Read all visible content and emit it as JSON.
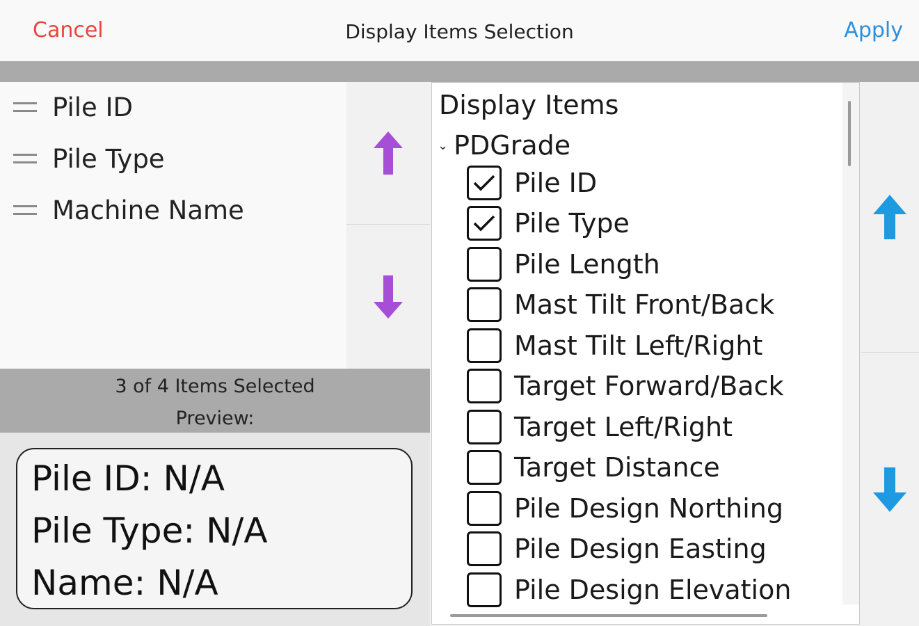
{
  "header": {
    "cancel_label": "Cancel",
    "title": "Display Items Selection",
    "apply_label": "Apply"
  },
  "selected_list": [
    {
      "label": "Pile ID"
    },
    {
      "label": "Pile Type"
    },
    {
      "label": "Machine Name"
    }
  ],
  "status": {
    "count_text": "3 of 4 Items Selected",
    "preview_label": "Preview:"
  },
  "preview": {
    "lines": [
      "Pile ID: N/A",
      "Pile Type: N/A",
      "Name: N/A"
    ]
  },
  "tree": {
    "title": "Display Items",
    "group": "PDGrade",
    "items": [
      {
        "label": "Pile ID",
        "checked": true
      },
      {
        "label": "Pile Type",
        "checked": true
      },
      {
        "label": "Pile Length",
        "checked": false
      },
      {
        "label": "Mast Tilt Front/Back",
        "checked": false
      },
      {
        "label": "Mast Tilt Left/Right",
        "checked": false
      },
      {
        "label": "Target Forward/Back",
        "checked": false
      },
      {
        "label": "Target Left/Right",
        "checked": false
      },
      {
        "label": "Target Distance",
        "checked": false
      },
      {
        "label": "Pile Design Northing",
        "checked": false
      },
      {
        "label": "Pile Design Easting",
        "checked": false
      },
      {
        "label": "Pile Design Elevation",
        "checked": false
      }
    ]
  },
  "colors": {
    "cancel": "#e8453c",
    "apply": "#2a8fe0",
    "purple_arrow": "#a64fd6",
    "blue_arrow": "#1e9ae0"
  },
  "icons": {
    "drag": "drag-handle-icon",
    "move_up": "arrow-up-icon",
    "move_down": "arrow-down-icon",
    "expand": "chevron-down-icon",
    "check": "checkmark-icon"
  }
}
